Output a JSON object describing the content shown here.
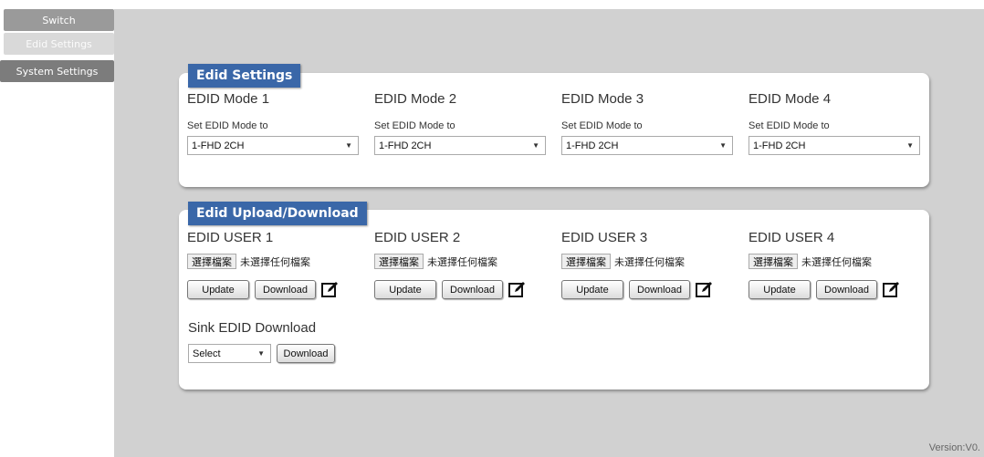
{
  "nav": {
    "switch": "Switch",
    "edid_settings": "Edid Settings",
    "system_settings": "System Settings"
  },
  "edid_settings_panel": {
    "title": "Edid Settings",
    "modes": [
      {
        "heading": "EDID Mode 1",
        "label": "Set EDID Mode to",
        "value": "1-FHD 2CH"
      },
      {
        "heading": "EDID Mode 2",
        "label": "Set EDID Mode to",
        "value": "1-FHD 2CH"
      },
      {
        "heading": "EDID Mode 3",
        "label": "Set EDID Mode to",
        "value": "1-FHD 2CH"
      },
      {
        "heading": "EDID Mode 4",
        "label": "Set EDID Mode to",
        "value": "1-FHD 2CH"
      }
    ]
  },
  "upload_panel": {
    "title": "Edid Upload/Download",
    "users": [
      {
        "heading": "EDID USER 1",
        "choose_file": "選擇檔案",
        "no_file": "未選擇任何檔案",
        "update": "Update",
        "download": "Download"
      },
      {
        "heading": "EDID USER 2",
        "choose_file": "選擇檔案",
        "no_file": "未選擇任何檔案",
        "update": "Update",
        "download": "Download"
      },
      {
        "heading": "EDID USER 3",
        "choose_file": "選擇檔案",
        "no_file": "未選擇任何檔案",
        "update": "Update",
        "download": "Download"
      },
      {
        "heading": "EDID USER 4",
        "choose_file": "選擇檔案",
        "no_file": "未選擇任何檔案",
        "update": "Update",
        "download": "Download"
      }
    ],
    "sink": {
      "heading": "Sink EDID Download",
      "select_value": "Select",
      "download": "Download"
    }
  },
  "version": "Version:V0.",
  "colors": {
    "accent": "#3a67a8",
    "content_bg": "#d1d1d1"
  }
}
